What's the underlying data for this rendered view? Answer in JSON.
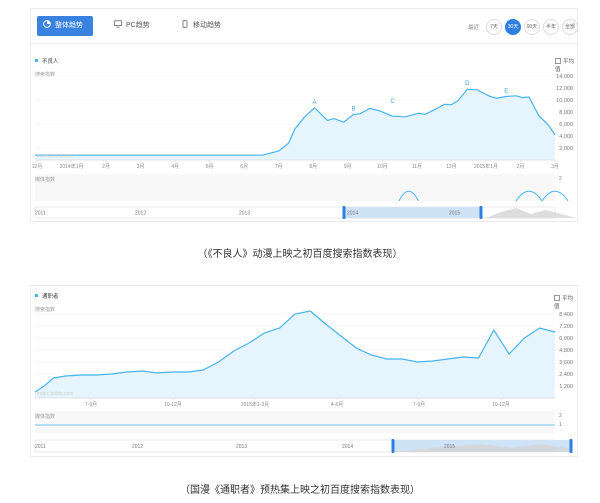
{
  "tabs": [
    {
      "label": "整体趋势",
      "icon": "pie-chart-icon",
      "active": true
    },
    {
      "label": "PC趋势",
      "icon": "monitor-icon",
      "active": false
    },
    {
      "label": "移动趋势",
      "icon": "mobile-icon",
      "active": false
    }
  ],
  "range": {
    "label": "最近",
    "buttons": [
      {
        "label": "7天",
        "active": false
      },
      {
        "label": "30天",
        "active": true
      },
      {
        "label": "90天",
        "active": false
      },
      {
        "label": "半年",
        "active": false
      },
      {
        "label": "全部",
        "active": false
      }
    ]
  },
  "colors": {
    "line": "#46b4f0",
    "fill": "#e6f4fd",
    "accent": "#2f7fe0",
    "news": "#46b4f0"
  },
  "chart1": {
    "legend": "不良人",
    "avg_label": "平均值",
    "ylabel": "搜索指数",
    "news_label": "媒体指数",
    "watermark": "index.baidu.com",
    "caption": "（《不良人》动漫上映之初百度搜索指数表现）"
  },
  "chart2": {
    "legend": "通职者",
    "avg_label": "平均值",
    "ylabel": "搜索指数",
    "news_label": "媒体指数",
    "watermark": "index.baidu.com",
    "caption": "（国漫《通职者》预热集上映之初百度搜索指数表现）"
  },
  "chart_data": [
    {
      "type": "area",
      "series": [
        {
          "name": "不良人",
          "x": [
            0,
            1,
            2,
            3,
            4,
            5,
            6,
            7,
            7.5,
            7.8,
            8,
            8.3,
            8.6,
            9,
            9.2,
            9.5,
            9.8,
            10,
            10.3,
            10.6,
            11,
            11.4,
            11.8,
            12,
            12.3,
            12.6,
            12.8,
            13,
            13.3,
            13.6,
            14,
            14.2,
            14.5,
            14.8,
            15,
            15.2,
            15.5,
            15.8,
            16
          ],
          "values": [
            800,
            800,
            800,
            800,
            800,
            800,
            800,
            800,
            1500,
            2800,
            5200,
            7200,
            8700,
            6600,
            6900,
            6300,
            7600,
            7700,
            8600,
            8200,
            7300,
            7200,
            7800,
            7600,
            8400,
            9300,
            9200,
            9800,
            11800,
            11700,
            10600,
            10300,
            10600,
            10700,
            10400,
            10500,
            7400,
            5800,
            4200
          ]
        }
      ],
      "categories": [
        "12月",
        "2014年1月",
        "2月",
        "3月",
        "4月",
        "5月",
        "6月",
        "7月",
        "8月",
        "9月",
        "10月",
        "11月",
        "12月",
        "2015年1月",
        "2月",
        "3月"
      ],
      "yticks": [
        2000,
        4000,
        6000,
        8000,
        10000,
        12000,
        14000
      ],
      "yticklabels": [
        "2,000",
        "4,000",
        "6,000",
        "8,000",
        "10,000",
        "12,000",
        "14,000"
      ],
      "ylim": [
        0,
        14500
      ],
      "annotations": [
        {
          "label": "A",
          "x": 8.6,
          "y": 8700
        },
        {
          "label": "B",
          "x": 9.8,
          "y": 7600
        },
        {
          "label": "C",
          "x": 11.0,
          "y": 8800
        },
        {
          "label": "D",
          "x": 13.3,
          "y": 11800
        },
        {
          "label": "E",
          "x": 14.5,
          "y": 10600
        }
      ],
      "news_series": {
        "x": [
          11.2,
          11.5,
          11.8,
          14.8,
          15.2,
          15.6,
          16.0,
          16.4
        ],
        "values": [
          0,
          1,
          0,
          0,
          1,
          0,
          1,
          0
        ]
      },
      "news_ylim": [
        0,
        2
      ],
      "news_yticks": [
        2
      ],
      "timeline_years": [
        "2011",
        "2012",
        "2013",
        "2014",
        "2015"
      ]
    },
    {
      "type": "area",
      "series": [
        {
          "name": "通职者",
          "x": [
            0,
            0.3,
            0.6,
            1,
            1.5,
            2,
            2.5,
            3,
            3.5,
            4,
            4.5,
            5,
            5.5,
            6,
            6.5,
            7,
            7.5,
            8,
            8.5,
            9,
            9.5,
            10,
            10.5,
            11,
            11.5,
            12,
            12.5,
            13,
            13.5,
            14,
            14.5,
            15,
            15.5,
            16,
            16.5,
            17
          ],
          "values": [
            600,
            1200,
            2000,
            2200,
            2300,
            2300,
            2400,
            2600,
            2700,
            2500,
            2600,
            2600,
            2800,
            3600,
            4700,
            5500,
            6500,
            7000,
            8400,
            8700,
            7400,
            6200,
            5000,
            4300,
            3900,
            3900,
            3600,
            3700,
            3900,
            4100,
            4000,
            6800,
            4400,
            6000,
            7000,
            6600
          ]
        }
      ],
      "categories": [
        "7-9月",
        "10-12月",
        "2015年1-3月",
        "4-6月",
        "7-9月",
        "10-12月"
      ],
      "yticks": [
        1200,
        2400,
        3600,
        4800,
        6000,
        7200,
        8400
      ],
      "yticklabels": [
        "1,200",
        "2,400",
        "3,600",
        "4,800",
        "6,000",
        "7,200",
        "8,400"
      ],
      "ylim": [
        0,
        9000
      ],
      "news_ylim": [
        0,
        2
      ],
      "news_yticks": [
        1,
        2
      ],
      "timeline_years": [
        "2011",
        "2012",
        "2013",
        "2014",
        "2015"
      ]
    }
  ]
}
